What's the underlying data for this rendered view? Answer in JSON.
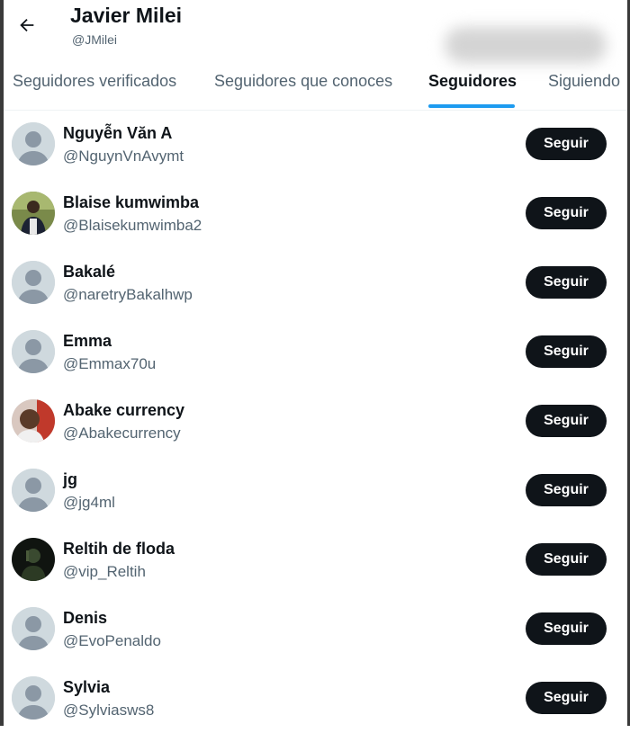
{
  "profile": {
    "name": "Javier Milei",
    "handle": "@JMilei"
  },
  "tabs": [
    {
      "label": "Seguidores verificados",
      "active": false
    },
    {
      "label": "Seguidores que conoces",
      "active": false
    },
    {
      "label": "Seguidores",
      "active": true
    },
    {
      "label": "Siguiendo",
      "active": false
    }
  ],
  "accent_color": "#1d9bf0",
  "follow_label": "Seguir",
  "followers": [
    {
      "name": "Nguyễn Văn A",
      "handle": "@NguynVnAvymt",
      "avatar": "default-avatar-icon"
    },
    {
      "name": "Blaise kumwimba",
      "handle": "@Blaisekumwimba2",
      "avatar": "photo"
    },
    {
      "name": "Bakalé",
      "handle": "@naretryBakalhwp",
      "avatar": "default-avatar-icon"
    },
    {
      "name": "Emma",
      "handle": "@Emmax70u",
      "avatar": "default-avatar-icon"
    },
    {
      "name": "Abake currency",
      "handle": "@Abakecurrency",
      "avatar": "photo"
    },
    {
      "name": "jg",
      "handle": "@jg4ml",
      "avatar": "default-avatar-icon"
    },
    {
      "name": "Reltih de floda",
      "handle": "@vip_Reltih",
      "avatar": "photo"
    },
    {
      "name": "Denis",
      "handle": "@EvoPenaldo",
      "avatar": "default-avatar-icon"
    },
    {
      "name": "Sylvia",
      "handle": "@Sylviasws8",
      "avatar": "default-avatar-icon"
    }
  ]
}
